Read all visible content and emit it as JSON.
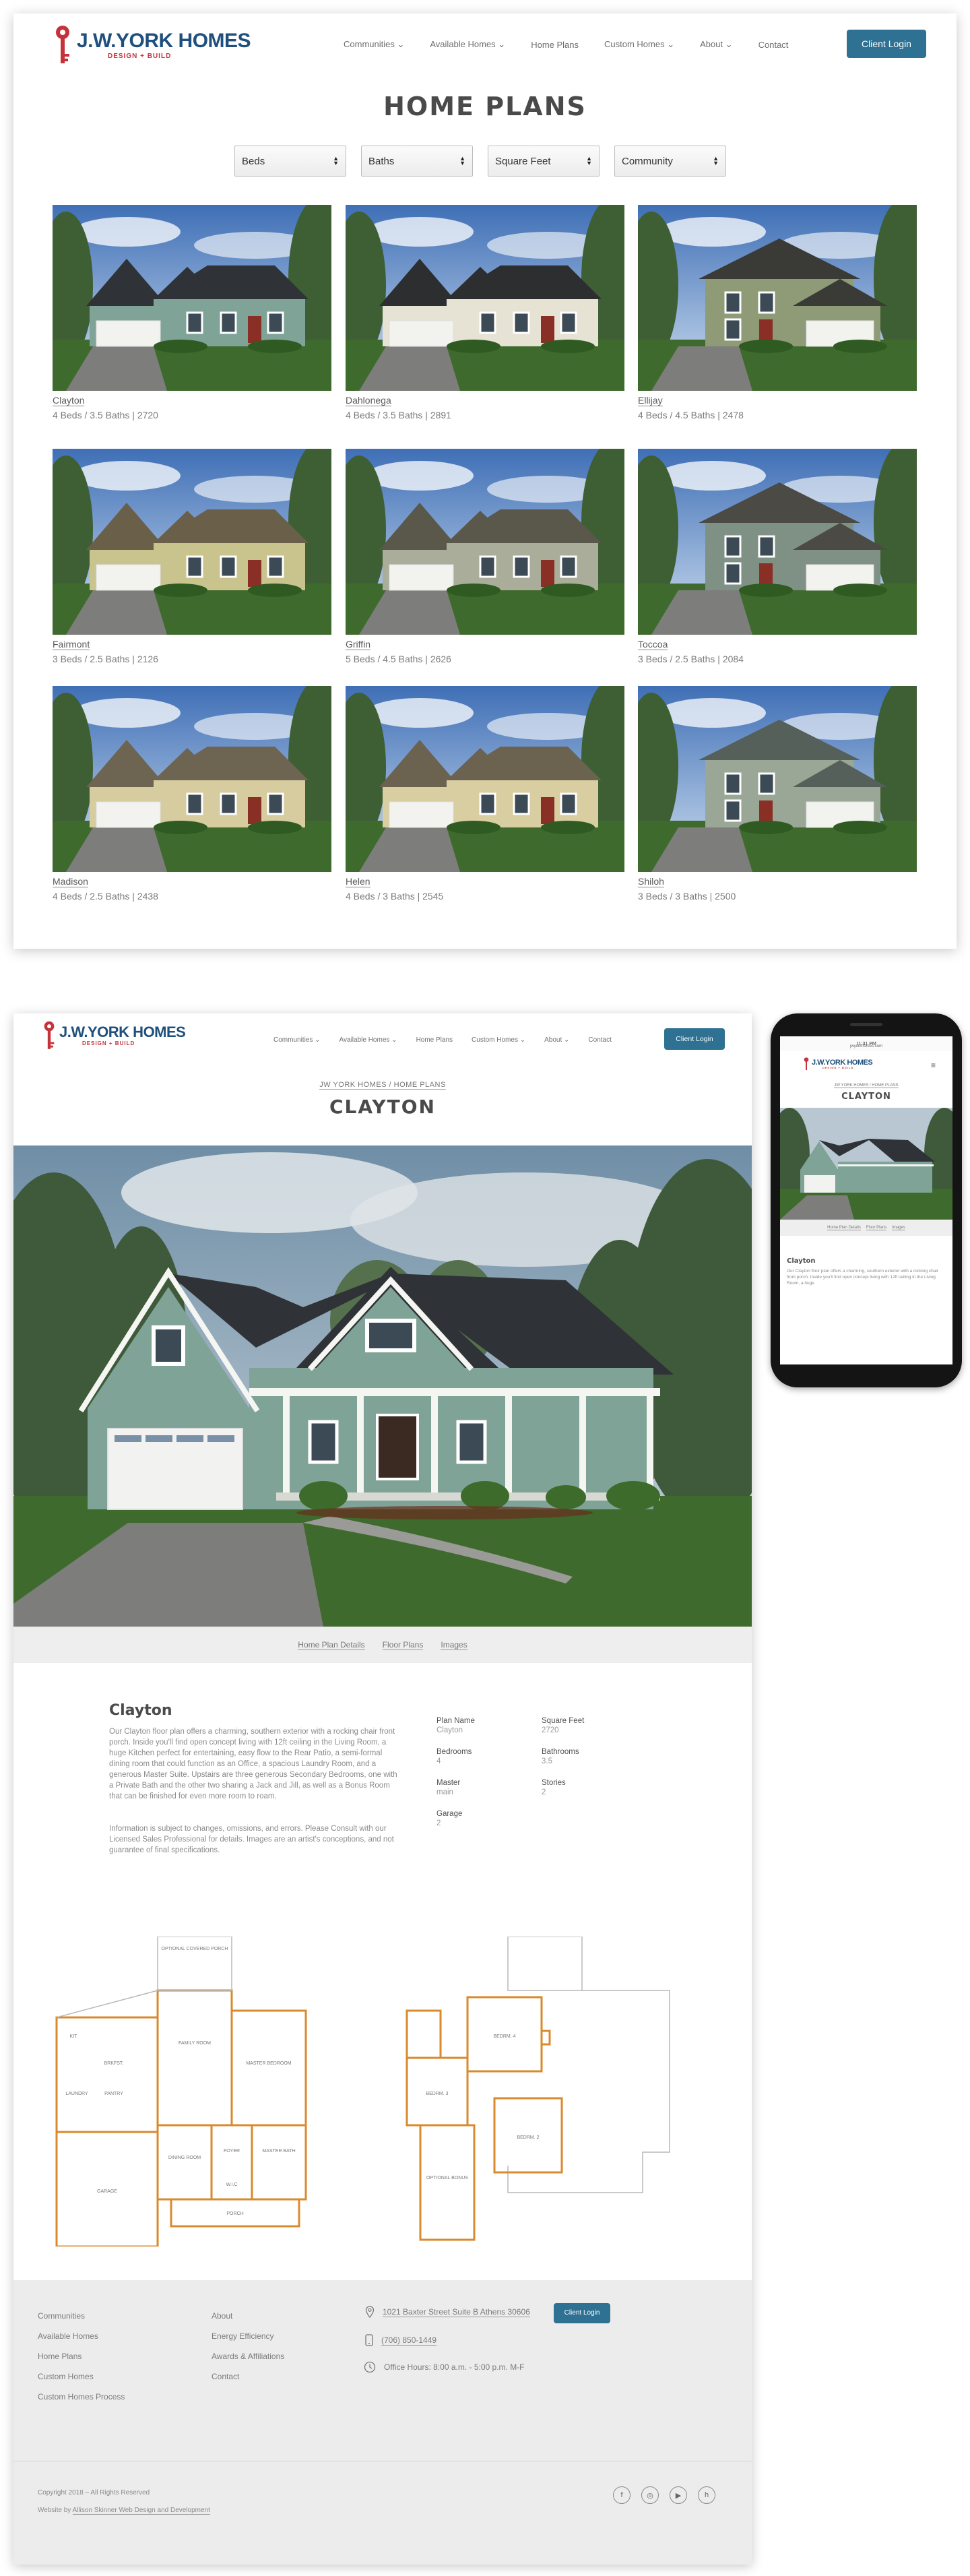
{
  "brand": {
    "name": "J.W.YORK HOMES",
    "tagline": "DESIGN + BUILD"
  },
  "nav": {
    "items": [
      {
        "label": "Communities",
        "dropdown": true
      },
      {
        "label": "Available Homes",
        "dropdown": true
      },
      {
        "label": "Home Plans",
        "dropdown": false
      },
      {
        "label": "Custom Homes",
        "dropdown": true
      },
      {
        "label": "About",
        "dropdown": true
      },
      {
        "label": "Contact",
        "dropdown": false
      }
    ],
    "login_label": "Client Login"
  },
  "listing": {
    "title": "HOME PLANS",
    "filters": [
      "Beds",
      "Baths",
      "Square Feet",
      "Community"
    ],
    "plans": [
      {
        "name": "Clayton",
        "desc": "4 Beds / 3.5 Baths | 2720",
        "wall": "#7fa397",
        "roof": "#2f3236"
      },
      {
        "name": "Dahlonega",
        "desc": "4 Beds / 3.5 Baths | 2891",
        "wall": "#e6e2d4",
        "roof": "#2c2e30"
      },
      {
        "name": "Ellijay",
        "desc": "4 Beds / 4.5 Baths | 2478",
        "wall": "#8f9a76",
        "roof": "#3a3b36"
      },
      {
        "name": "Fairmont",
        "desc": "3 Beds / 2.5 Baths | 2126",
        "wall": "#c9c48e",
        "roof": "#6a6049"
      },
      {
        "name": "Griffin",
        "desc": "5 Beds / 4.5 Baths | 2626",
        "wall": "#a9ad9a",
        "roof": "#5a574b"
      },
      {
        "name": "Toccoa",
        "desc": "3 Beds / 2.5 Baths | 2084",
        "wall": "#7f9184",
        "roof": "#4b4a44"
      },
      {
        "name": "Madison",
        "desc": "4 Beds / 2.5 Baths | 2438",
        "wall": "#d6cca0",
        "roof": "#6d6452"
      },
      {
        "name": "Helen",
        "desc": "4 Beds / 3 Baths | 2545",
        "wall": "#d8cea2",
        "roof": "#6b624f"
      },
      {
        "name": "Shiloh",
        "desc": "3 Beds / 3 Baths | 2500",
        "wall": "#9aa696",
        "roof": "#55605a"
      }
    ]
  },
  "detail": {
    "breadcrumb": "JW YORK HOMES / HOME PLANS",
    "title": "CLAYTON",
    "tabs": [
      "Home Plan Details",
      "Floor Plans",
      "Images"
    ],
    "plan_heading": "Clayton",
    "description": "Our Clayton floor plan offers a charming, southern exterior with a rocking chair front porch. Inside you'll find open concept living with 12ft ceiling in the Living Room, a huge Kitchen perfect for entertaining, easy flow to the Rear Patio, a semi-formal dining room that could function as an Office, a spacious Laundry Room, and a generous Master Suite. Upstairs are three generous Secondary Bedrooms, one with a Private Bath and the other two sharing a Jack and Jill, as well as a Bonus Room that can be finished for even more room to roam.",
    "disclaimer": "Information is subject to changes, omissions, and errors. Please Consult with our Licensed Sales Professional for details. Images are an artist's conceptions, and not guarantee of final specifications.",
    "specs": {
      "plan_name_label": "Plan Name",
      "plan_name": "Clayton",
      "sqft_label": "Square Feet",
      "sqft": "2720",
      "bedrooms_label": "Bedrooms",
      "bedrooms": "4",
      "bathrooms_label": "Bathrooms",
      "bathrooms": "3.5",
      "master_label": "Master",
      "master": "main",
      "stories_label": "Stories",
      "stories": "2",
      "garage_label": "Garage",
      "garage": "2"
    },
    "floorplan_labels": {
      "main": [
        "OPTIONAL COVERED PORCH",
        "KIT",
        "BRKFST.",
        "FAMILY ROOM",
        "MASTER BEDROOM",
        "LAUNDRY",
        "PANTRY",
        "DINING ROOM",
        "FOYER",
        "MASTER BATH",
        "W.I.C",
        "GARAGE",
        "PORCH"
      ],
      "upper": [
        "BEDRM. 4",
        "BEDRM. 3",
        "BEDRM. 2",
        "OPTIONAL BONUS"
      ]
    }
  },
  "footer": {
    "col1": [
      "Communities",
      "Available Homes",
      "Home Plans",
      "Custom Homes",
      "Custom Homes Process"
    ],
    "col2": [
      "About",
      "Energy Efficiency",
      "Awards & Affiliations",
      "Contact"
    ],
    "address": "1021 Baxter Street Suite B Athens 30606",
    "phone": "(706) 850-1449",
    "hours": "Office Hours: 8:00 a.m. - 5:00 p.m. M-F",
    "login_label": "Client Login",
    "copyright": "Copyright 2018 – All Rights Reserved",
    "credit_prefix": "Website by",
    "credit_link": "Allison Skinner Web Design and Development"
  },
  "phone": {
    "status_time": "11:31 PM",
    "url": "jwyorkhomes.com",
    "breadcrumb": "JW YORK HOMES / HOME PLANS",
    "title": "CLAYTON",
    "tabs": [
      "Home Plan Details",
      "Floor Plans",
      "Images"
    ],
    "heading": "Clayton",
    "text": "Our Clayton floor plan offers a charming, southern exterior with a rocking chair front porch. Inside you'll find open concept living with 12ft ceiling in the Living Room, a huge"
  },
  "colors": {
    "accent": "#2e7192",
    "brand_blue": "#1f4f7c",
    "brand_red": "#c6323a",
    "plan_orange": "#d98a2e"
  }
}
